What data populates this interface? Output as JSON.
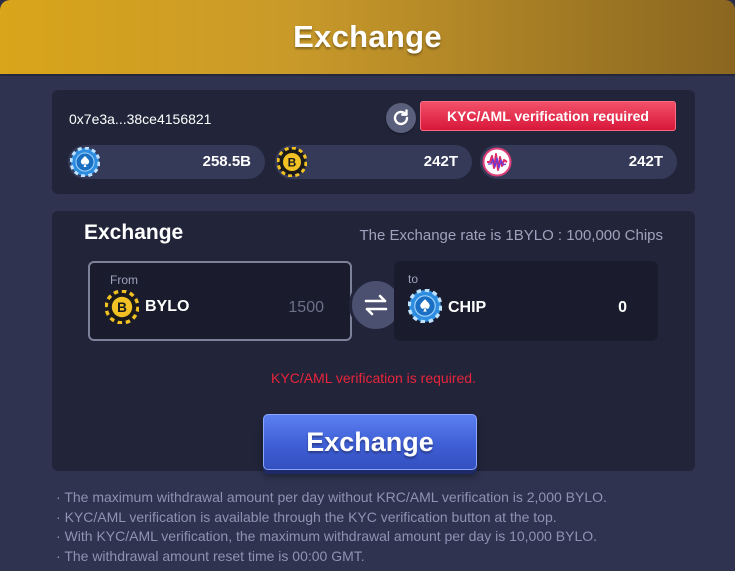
{
  "header": {
    "title": "Exchange"
  },
  "wallet": {
    "address": "0x7e3a...38ce4156821",
    "kyc_button_label": "KYC/AML verification required",
    "balances": [
      {
        "icon": "chip-icon",
        "value": "258.5B"
      },
      {
        "icon": "bylo-coin-icon",
        "value": "242T"
      },
      {
        "icon": "wave-token-icon",
        "value": "242T"
      }
    ]
  },
  "exchange": {
    "title": "Exchange",
    "rate_text": "The Exchange rate is 1BYLO : 100,000 Chips",
    "from": {
      "label": "From",
      "coin": "BYLO",
      "amount": "1500"
    },
    "to": {
      "label": "to",
      "coin": "CHIP",
      "amount": "0"
    },
    "error": "KYC/AML verification is required.",
    "button_label": "Exchange"
  },
  "notes": [
    "The maximum withdrawal amount per day without KRC/AML verification is 2,000 BYLO.",
    "KYC/AML verification is available through the KYC verification button at the top.",
    "With KYC/AML verification, the maximum withdrawal amount per day is 10,000 BYLO.",
    "The withdrawal amount reset time is 00:00 GMT."
  ],
  "colors": {
    "header_gold": "#d9a51a",
    "kyc_red": "#e8243b",
    "button_blue": "#4a6be0",
    "panel_bg": "#22253a"
  }
}
